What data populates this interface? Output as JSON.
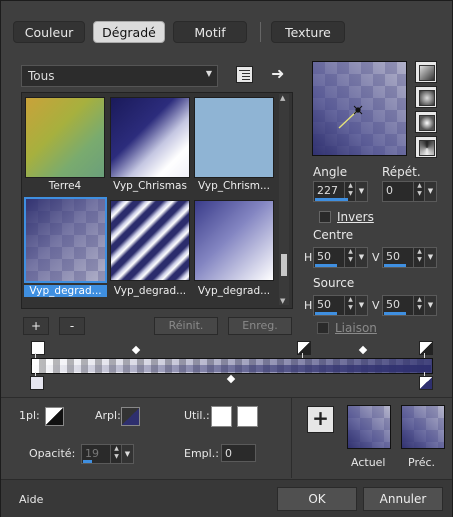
{
  "tabs": [
    {
      "label": "Couleur",
      "active": false
    },
    {
      "label": "Dégradé",
      "active": true
    },
    {
      "label": "Motif",
      "active": false
    },
    {
      "label": "Texture",
      "active": false
    }
  ],
  "category_select": {
    "value": "Tous"
  },
  "gradients": [
    {
      "label": "Terre4",
      "selected": false
    },
    {
      "label": "Vyp_Chrismas",
      "selected": false
    },
    {
      "label": "Vyp_Chrism...",
      "selected": false
    },
    {
      "label": "Vyp_degrad...",
      "selected": true
    },
    {
      "label": "Vyp_degrad...",
      "selected": false
    },
    {
      "label": "Vyp_degrad...",
      "selected": false
    }
  ],
  "list_buttons": {
    "add": "+",
    "remove": "-",
    "reset": "Réinit.",
    "save": "Enreg."
  },
  "angle": {
    "label": "Angle",
    "value": "227"
  },
  "repeat": {
    "label": "Répét.",
    "value": "0"
  },
  "invert": {
    "label": "Invers",
    "checked": false
  },
  "center": {
    "label": "Centre",
    "h_label": "H",
    "h": "50",
    "v_label": "V",
    "v": "50"
  },
  "source": {
    "label": "Source",
    "h_label": "H",
    "h": "50",
    "v_label": "V",
    "v": "50"
  },
  "link": {
    "label": "Liaison",
    "checked": false
  },
  "stops_row": {
    "foreground_label": "1pl:",
    "background_label": "Arpl:",
    "user_label": "Util.:",
    "opacity_label": "Opacité:",
    "opacity_value": "19",
    "location_label": "Empl.:",
    "location_value": "0"
  },
  "preview": {
    "current_label": "Actuel",
    "previous_label": "Préc."
  },
  "footer": {
    "help": "Aide",
    "ok": "OK",
    "cancel": "Annuler"
  },
  "colors": {
    "accent": "#3f8fe0",
    "gradient_dark": "#2e2f6e",
    "gradient_light": "#e6e6f0"
  }
}
